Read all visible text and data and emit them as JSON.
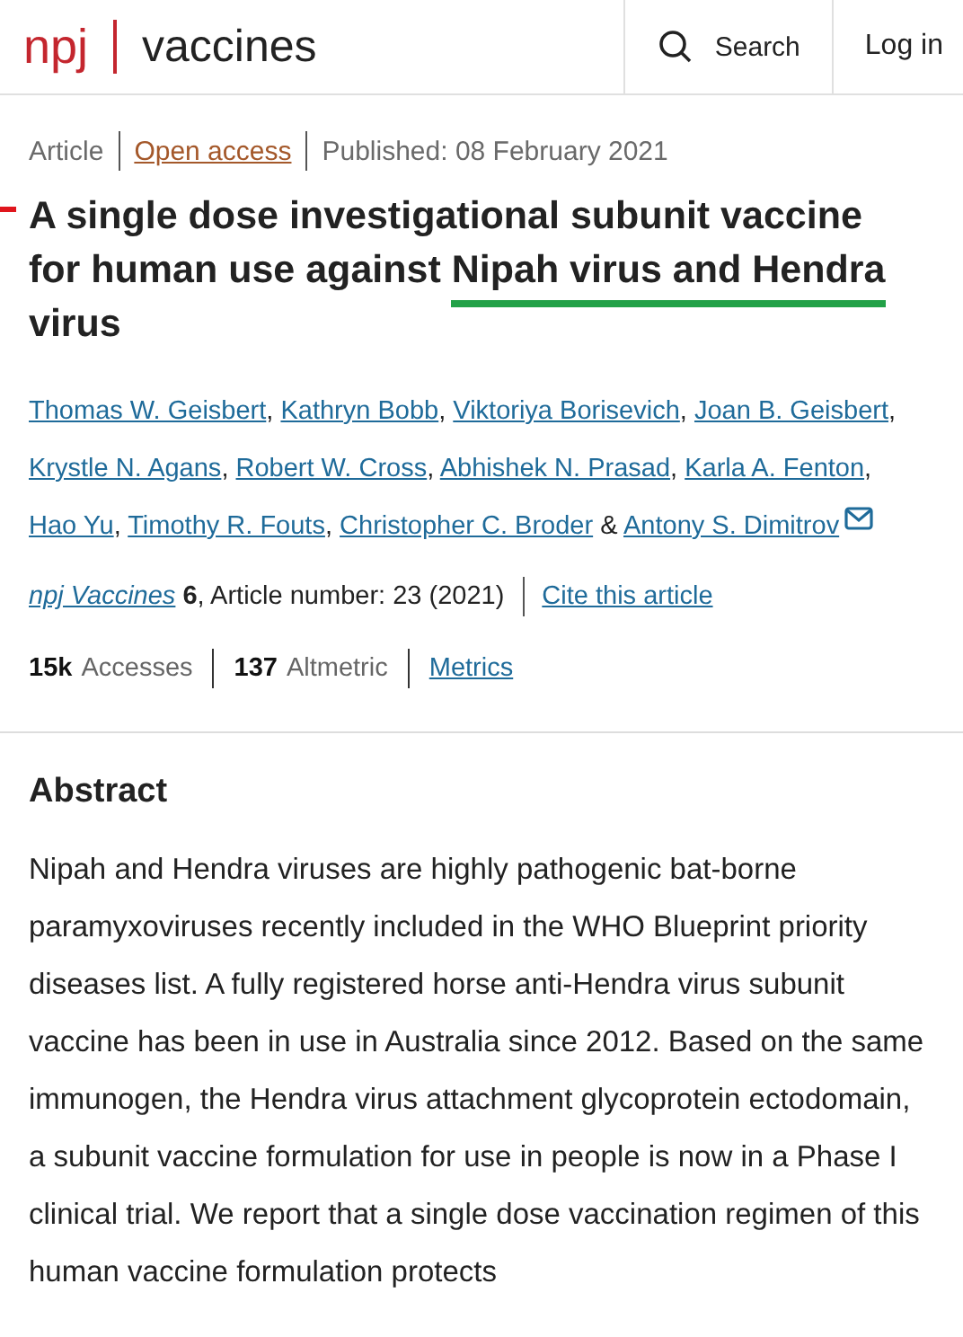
{
  "header": {
    "logo_brand": "npj",
    "logo_title": "vaccines",
    "search_label": "Search",
    "login_label": "Log in"
  },
  "meta": [
    {
      "kind": "text",
      "text": "Article"
    },
    {
      "kind": "link",
      "text": "Open access"
    },
    {
      "kind": "text",
      "text": "Published: 08 February 2021"
    }
  ],
  "title": [
    {
      "text": "A single dose investigational subunit vaccine for human use against ",
      "highlighted": false
    },
    {
      "text": "Nipah virus and Hendra",
      "highlighted": true
    },
    {
      "text": " virus",
      "highlighted": false
    }
  ],
  "authors": [
    {
      "name": "Thomas W. Geisbert",
      "separator": ", "
    },
    {
      "name": "Kathryn Bobb",
      "separator": ", "
    },
    {
      "name": "Viktoriya Borisevich",
      "separator": ", "
    },
    {
      "name": "Joan B. Geisbert",
      "separator": ", "
    },
    {
      "name": "Krystle N. Agans",
      "separator": ", "
    },
    {
      "name": "Robert W. Cross",
      "separator": ", "
    },
    {
      "name": "Abhishek N. Prasad",
      "separator": ", "
    },
    {
      "name": "Karla A. Fenton",
      "separator": ", "
    },
    {
      "name": "Hao Yu",
      "separator": ", "
    },
    {
      "name": "Timothy R. Fouts",
      "separator": ", "
    },
    {
      "name": "Christopher C. Broder",
      "separator": " & "
    },
    {
      "name": "Antony S. Dimitrov",
      "email": true
    }
  ],
  "citation": {
    "journal": "npj Vaccines",
    "volume": "6",
    "details": ", Article number: 23 (2021)",
    "cite_link": "Cite this article"
  },
  "metrics": [
    {
      "kind": "stat",
      "count": "15k",
      "unit": "Accesses"
    },
    {
      "kind": "stat",
      "count": "137",
      "unit": "Altmetric"
    },
    {
      "kind": "link",
      "label": "Metrics"
    }
  ],
  "abstract": {
    "heading": "Abstract",
    "text": "Nipah and Hendra viruses are highly pathogenic bat-borne paramyxoviruses recently included in the WHO Blueprint priority diseases list. A fully registered horse anti-Hendra virus subunit vaccine has been in use in Australia since 2012. Based on the same immunogen, the Hendra virus attachment glycoprotein ectodomain, a subunit vaccine formulation for use in people is now in a Phase I clinical trial. We report that a single dose vaccination regimen of this human vaccine formulation protects"
  }
}
